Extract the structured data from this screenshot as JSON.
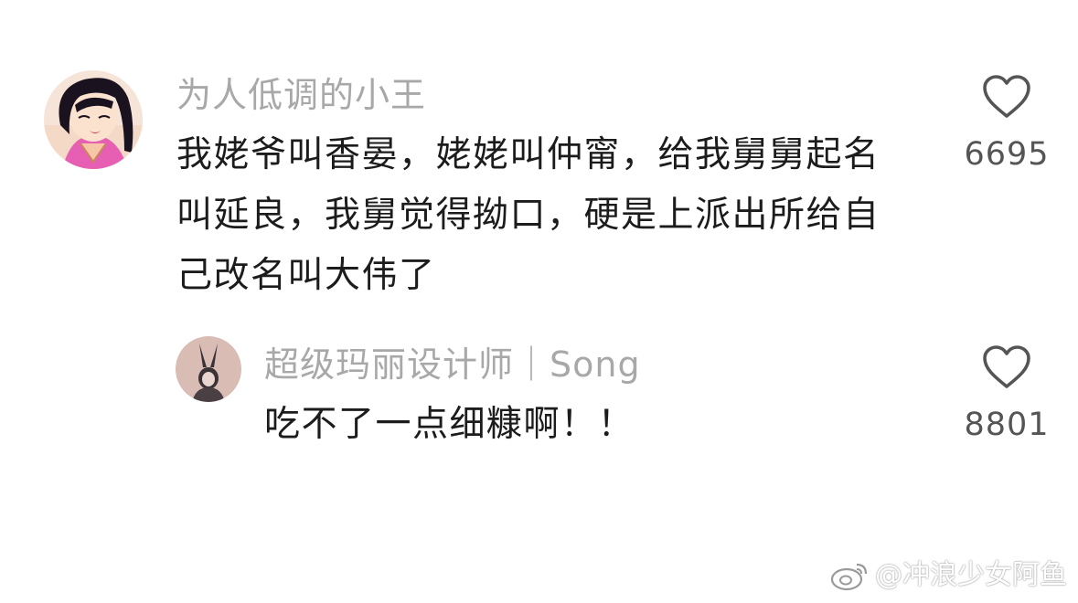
{
  "comments": [
    {
      "username": "为人低调的小王",
      "text_lines": [
        "我姥爷叫香晏，姥姥叫仲甯，给我舅舅起名",
        "叫延良，我舅觉得拗口，硬是上派出所给自",
        "己改名叫大伟了"
      ],
      "like_count": "6695"
    }
  ],
  "reply": {
    "username": "超级玛丽设计师｜Song",
    "text": "吃不了一点细糠啊！！",
    "like_count": "8801"
  },
  "watermark": {
    "text": "@冲浪少女阿鱼",
    "icon": "weibo-logo-icon"
  },
  "colors": {
    "username": "#a8a8a8",
    "text": "#1c1c1c",
    "like_count": "#555555",
    "icon_stroke": "#555555"
  }
}
